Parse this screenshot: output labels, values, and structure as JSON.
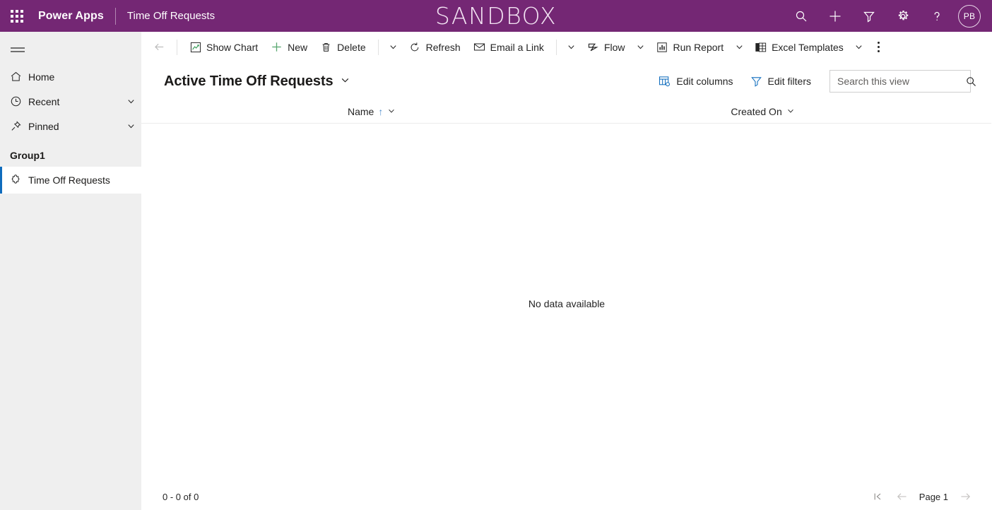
{
  "header": {
    "waffle_icon": "app-launcher-icon",
    "brand": "Power Apps",
    "app_name": "Time Off Requests",
    "environment_banner": "SANDBOX",
    "actions": [
      {
        "name": "search-icon",
        "label": "Search"
      },
      {
        "name": "plus-icon",
        "label": "New"
      },
      {
        "name": "filter-icon",
        "label": "Filter"
      },
      {
        "name": "gear-icon",
        "label": "Settings"
      },
      {
        "name": "help-icon",
        "label": "Help"
      }
    ],
    "avatar_initials": "PB",
    "background_color": "#742774"
  },
  "sidebar": {
    "hamburger_icon": "hamburger-icon",
    "items": [
      {
        "label": "Home",
        "icon": "home-icon",
        "has_chevron": false
      },
      {
        "label": "Recent",
        "icon": "clock-icon",
        "has_chevron": true
      },
      {
        "label": "Pinned",
        "icon": "pin-icon",
        "has_chevron": true
      }
    ],
    "group_title": "Group1",
    "entity": {
      "label": "Time Off Requests",
      "icon": "puzzle-icon",
      "selected": true
    },
    "background_color": "#efefef",
    "selected_accent": "#0f6cbd"
  },
  "commandbar": {
    "back_icon": "back-arrow-icon",
    "buttons": [
      {
        "label": "Show Chart",
        "icon": "chart-icon"
      },
      {
        "label": "New",
        "icon": "plus-icon"
      },
      {
        "label": "Delete",
        "icon": "trash-icon"
      },
      {
        "label": "Refresh",
        "icon": "refresh-icon"
      },
      {
        "label": "Email a Link",
        "icon": "email-link-icon"
      },
      {
        "label": "Flow",
        "icon": "flow-icon"
      },
      {
        "label": "Run Report",
        "icon": "report-icon"
      },
      {
        "label": "Excel Templates",
        "icon": "excel-icon"
      }
    ],
    "overflow_label": "More commands"
  },
  "view": {
    "title": "Active Time Off Requests",
    "edit_columns": "Edit columns",
    "edit_filters": "Edit filters",
    "search_placeholder": "Search this view",
    "search_value": "",
    "accent_color": "#0f6cbd"
  },
  "grid": {
    "columns": [
      {
        "label": "Name",
        "sorted": true,
        "sort_direction": "asc",
        "sort_glyph": "↑"
      },
      {
        "label": "Created On",
        "sorted": false
      }
    ],
    "rows": [],
    "empty_message": "No data available"
  },
  "footer": {
    "record_count": "0 - 0 of 0",
    "page_label": "Page 1",
    "first_page_icon": "first-page-icon",
    "prev_page_icon": "previous-page-icon",
    "next_page_icon": "next-page-icon"
  }
}
